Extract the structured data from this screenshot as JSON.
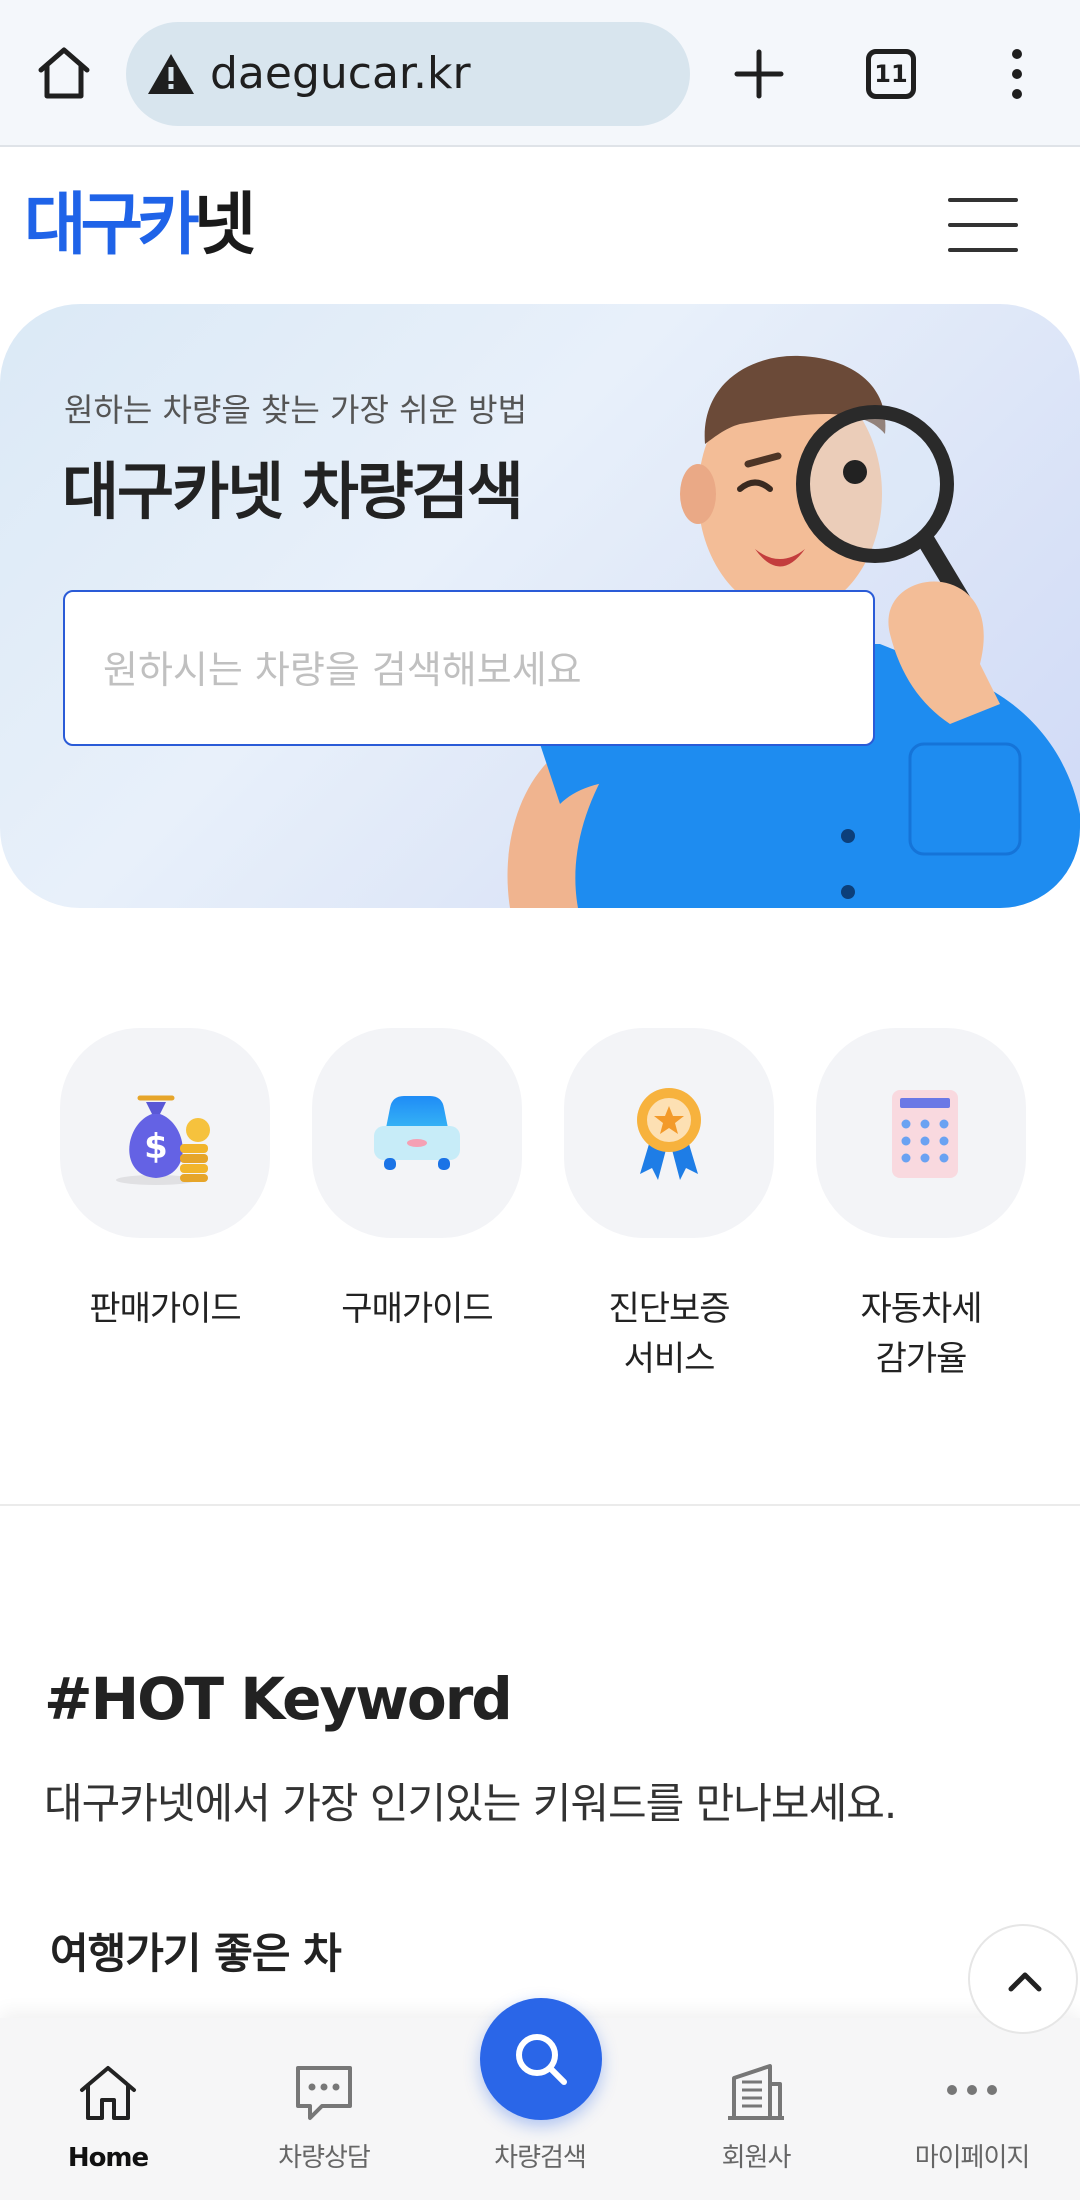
{
  "browser": {
    "url": "daegucar.kr",
    "tab_count": "11"
  },
  "site": {
    "logo_part1": "대구카",
    "logo_part2": "넷"
  },
  "hero": {
    "subtitle": "원하는 차량을 찾는 가장 쉬운 방법",
    "title": "대구카넷 차량검색",
    "search_placeholder": "원하시는 차량을 검색해보세요"
  },
  "quick_menu": [
    {
      "label": "판매가이드",
      "icon": "money-bag-icon"
    },
    {
      "label": "구매가이드",
      "icon": "car-icon"
    },
    {
      "label_line1": "진단보증",
      "label_line2": "서비스",
      "icon": "award-medal-icon"
    },
    {
      "label_line1": "자동차세",
      "label_line2": "감가율",
      "icon": "calculator-icon"
    }
  ],
  "hot_keyword": {
    "title": "#HOT Keyword",
    "subtitle": "대구카넷에서 가장 인기있는 키워드를 만나보세요.",
    "first_group": "여행가기 좋은 차"
  },
  "bottom_nav": [
    {
      "label": "Home",
      "icon": "home-icon",
      "active": true
    },
    {
      "label": "차량상담",
      "icon": "chat-icon"
    },
    {
      "label": "차량검색",
      "icon": "search-icon"
    },
    {
      "label": "회원사",
      "icon": "building-icon"
    },
    {
      "label": "마이페이지",
      "icon": "more-icon"
    }
  ],
  "colors": {
    "brand_blue": "#1f63e8",
    "nav_search_blue": "#2a66e8"
  }
}
